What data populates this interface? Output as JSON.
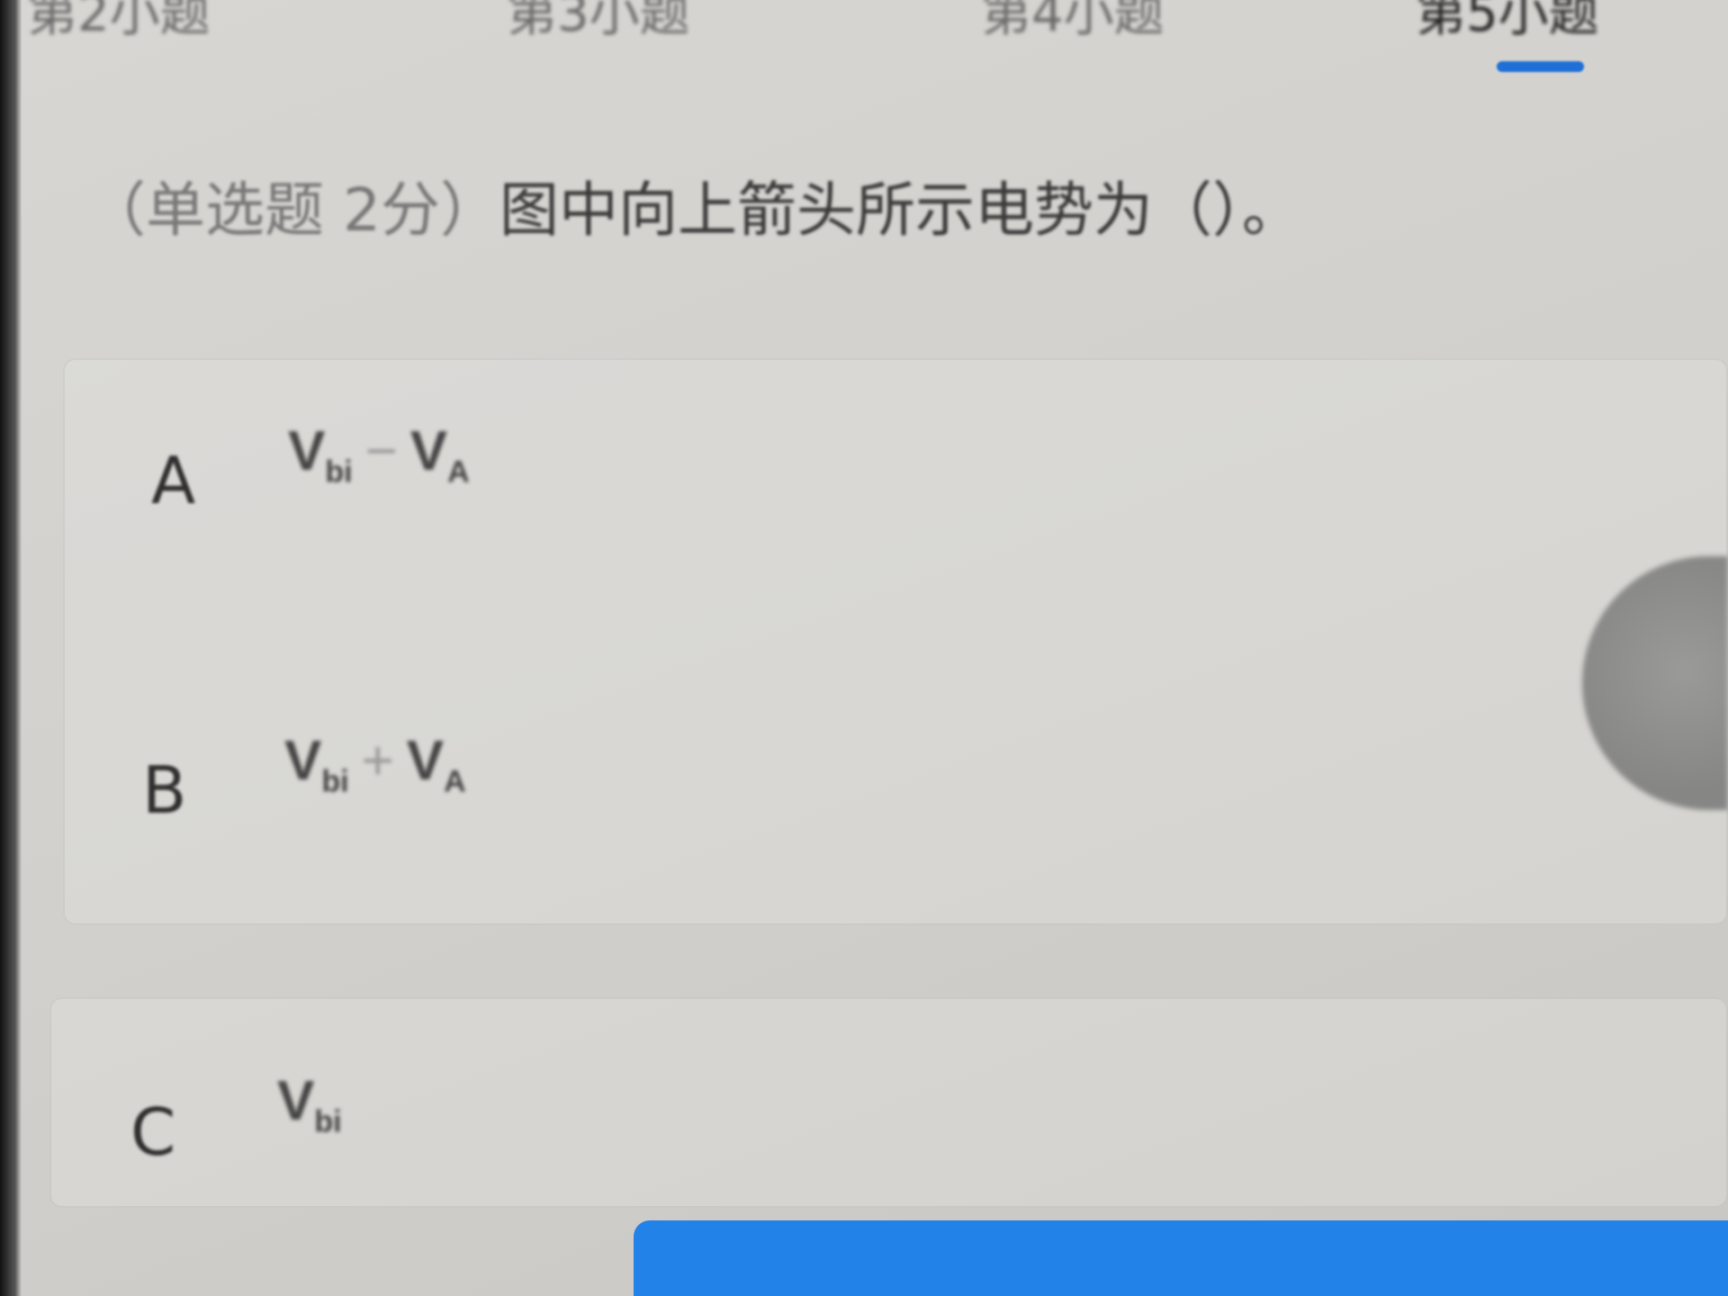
{
  "tabs": [
    {
      "label": "第2小题",
      "active": false
    },
    {
      "label": "第3小题",
      "active": false
    },
    {
      "label": "第4小题",
      "active": false
    },
    {
      "label": "第5小题",
      "active": true
    }
  ],
  "accent_color": "#1f6fd6",
  "question": {
    "type": "（单选题 2分）",
    "text": "图中向上箭头所示电势为（）。"
  },
  "options": [
    {
      "letter": "A",
      "v1": "V",
      "s1": "bi",
      "op": "−",
      "v2": "V",
      "s2": "A"
    },
    {
      "letter": "B",
      "v1": "V",
      "s1": "bi",
      "op": "+",
      "v2": "V",
      "s2": "A"
    },
    {
      "letter": "C",
      "v1": "V",
      "s1": "bi"
    }
  ]
}
